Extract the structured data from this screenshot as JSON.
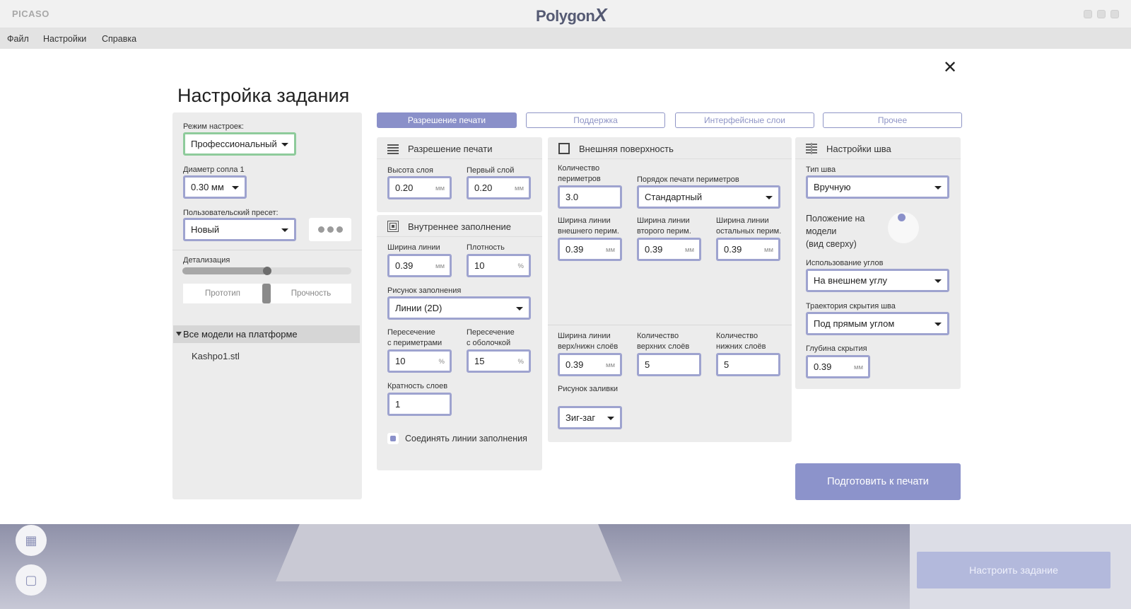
{
  "app": {
    "name": "PICASO",
    "logo": "Polygon",
    "logo_x": "X"
  },
  "menu": {
    "file": "Файл",
    "settings": "Настройки",
    "help": "Справка"
  },
  "viewport": {
    "setup_button": "Настроить задание"
  },
  "modal": {
    "title": "Настройка задания",
    "close_glyph": "✕",
    "left": {
      "mode_label": "Режим настроек:",
      "mode_value": "Профессиональный",
      "nozzle_label": "Диаметр сопла 1",
      "nozzle_value": "0.30 мм",
      "preset_label": "Пользовательский пресет:",
      "preset_value": "Новый",
      "detail_label": "Детализация",
      "detail_level": 0.5,
      "seg_left": "Прототип",
      "seg_right": "Прочность",
      "tree_header": "Все модели на платформе",
      "models": [
        "Kashpo1.stl"
      ]
    },
    "tabs": [
      "Разрешение печати",
      "Поддержка",
      "Интерфейсные слои",
      "Прочее"
    ],
    "resolution": {
      "title": "Разрешение печати",
      "layer_height_label": "Высота слоя",
      "layer_height": "0.20",
      "first_layer_label": "Первый слой",
      "first_layer": "0.20",
      "unit_mm": "мм"
    },
    "infill": {
      "title": "Внутреннее заполнение",
      "line_width_label": "Ширина линии",
      "line_width": "0.39",
      "density_label": "Плотность",
      "density": "10",
      "pattern_label": "Рисунок заполнения",
      "pattern": "Линии (2D)",
      "overlap_perim_label1": "Пересечение",
      "overlap_perim_label2": "с периметрами",
      "overlap_perim": "10",
      "overlap_shell_label1": "Пересечение",
      "overlap_shell_label2": "с оболочкой",
      "overlap_shell": "15",
      "multiplicity_label": "Кратность слоев",
      "multiplicity": "1",
      "connect_label": "Соединять линии заполнения",
      "unit_pct": "%"
    },
    "outer": {
      "title": "Внешняя поверхность",
      "perim_count_label1": "Количество",
      "perim_count_label2": "периметров",
      "perim_count": "3.0",
      "perim_order_label": "Порядок печати периметров",
      "perim_order": "Стандартный",
      "w_outer_label1": "Ширина линии",
      "w_outer_label2": "внешнего перим.",
      "w_outer": "0.39",
      "w_second_label1": "Ширина линии",
      "w_second_label2": "второго перим.",
      "w_second": "0.39",
      "w_rest_label1": "Ширина линии",
      "w_rest_label2": "остальных перим.",
      "w_rest": "0.39",
      "w_topbot_label1": "Ширина линии",
      "w_topbot_label2": "верх/нижн слоёв",
      "w_topbot": "0.39",
      "top_count_label1": "Количество",
      "top_count_label2": "верхних слоёв",
      "top_count": "5",
      "bottom_count_label1": "Количество",
      "bottom_count_label2": "нижних слоёв",
      "bottom_count": "5",
      "fill_pattern_label": "Рисунок заливки",
      "fill_pattern": "Зиг-заг"
    },
    "seam": {
      "title": "Настройки шва",
      "type_label": "Тип шва",
      "type": "Вручную",
      "position_label1": "Положение на",
      "position_label2": "модели",
      "position_label3": "(вид сверху)",
      "corners_label": "Использование углов",
      "corners": "На внешнем углу",
      "path_label": "Траектория скрытия шва",
      "path": "Под прямым углом",
      "depth_label": "Глубина скрытия",
      "depth": "0.39"
    },
    "prepare_button": "Подготовить к печати"
  }
}
